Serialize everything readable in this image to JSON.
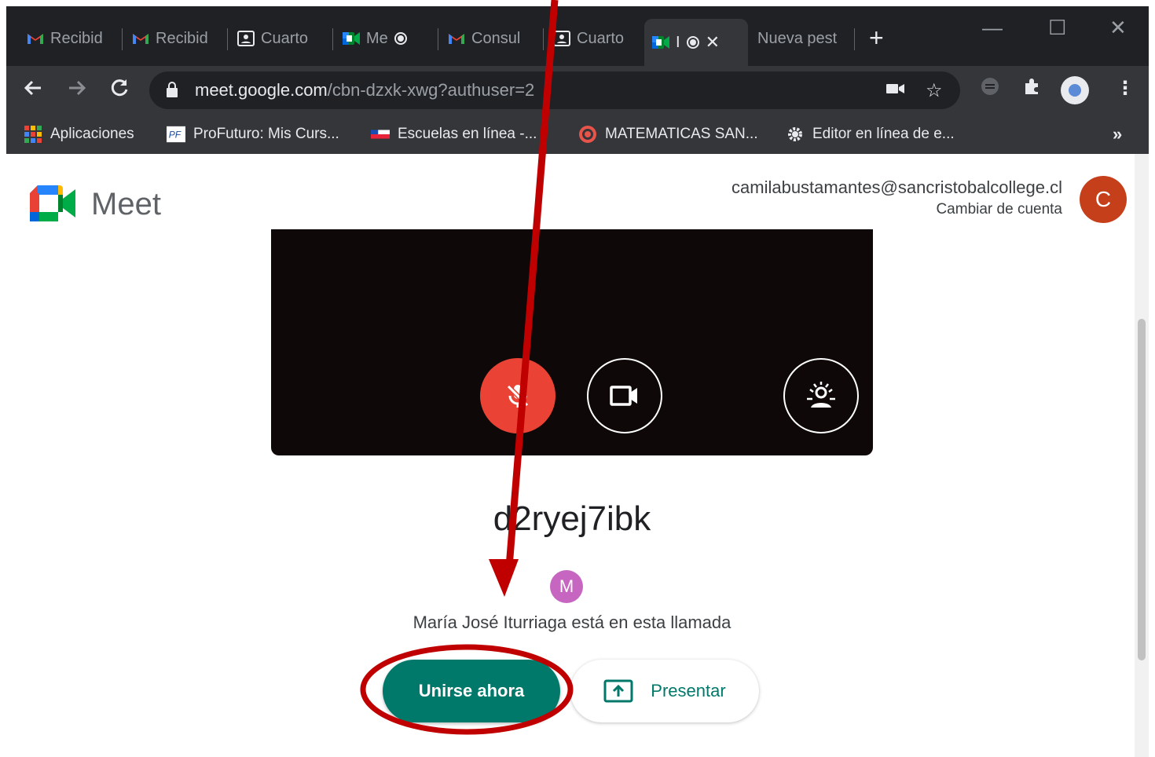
{
  "browser": {
    "tabs": [
      {
        "label": "Recibid",
        "icon": "gmail-icon"
      },
      {
        "label": "Recibid",
        "icon": "gmail-icon"
      },
      {
        "label": "Cuarto",
        "icon": "classroom-icon"
      },
      {
        "label": "Me",
        "icon": "meet-icon",
        "recording": true
      },
      {
        "label": "Consul",
        "icon": "gmail-icon"
      },
      {
        "label": "Cuarto",
        "icon": "classroom-icon"
      },
      {
        "label": "I",
        "icon": "meet-icon",
        "recording": true,
        "active": true
      },
      {
        "label": "Nueva pest",
        "icon": "none"
      }
    ],
    "new_tab": "+",
    "window_controls": {
      "minimize": "—",
      "maximize": "☐",
      "close": "✕"
    },
    "address": {
      "host": "meet.google.com",
      "path": "/cbn-dzxk-xwg?authuser=2"
    },
    "bookmarks": [
      {
        "label": "Aplicaciones",
        "icon": "apps-grid-icon"
      },
      {
        "label": "ProFuturo: Mis Curs...",
        "icon": "profuturo-icon"
      },
      {
        "label": "Escuelas en línea -...",
        "icon": "flag-icon"
      },
      {
        "label": "MATEMATICAS SAN...",
        "icon": "target-icon"
      },
      {
        "label": "Editor en línea de e...",
        "icon": "gear-icon"
      }
    ],
    "bookmarks_more": "»"
  },
  "meet": {
    "brand": "Meet",
    "account": {
      "email": "camilabustamantes@sancristobalcollege.cl",
      "switch_label": "Cambiar de cuenta",
      "avatar_letter": "C",
      "avatar_color": "#c5401a"
    },
    "preview": {
      "mic_state": "muted",
      "camera_state": "on"
    },
    "meeting_code": "d2ryej7ibk",
    "participant": {
      "avatar_letter": "M",
      "text": "María José Iturriaga está en esta llamada"
    },
    "join_label": "Unirse ahora",
    "present_label": "Presentar",
    "accent_color": "#00796b"
  },
  "annotation": {
    "color": "#c00000"
  }
}
